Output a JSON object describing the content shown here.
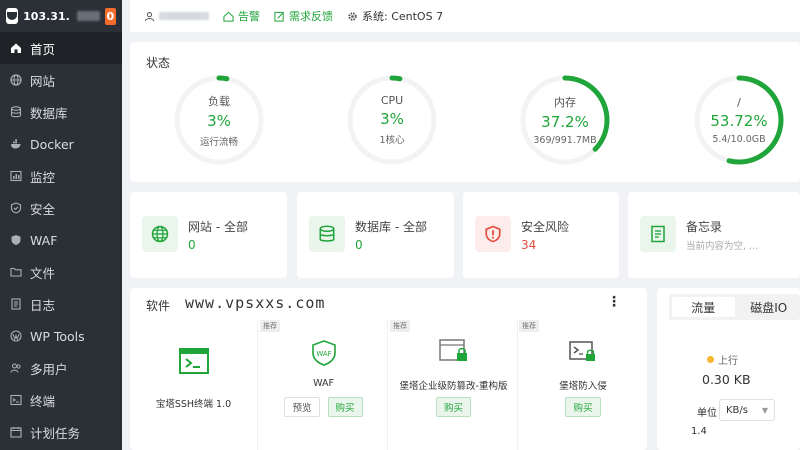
{
  "sidebar": {
    "ip": "103.31.",
    "badge": "0",
    "items": [
      {
        "label": "首页",
        "icon": "home-icon"
      },
      {
        "label": "网站",
        "icon": "globe-icon"
      },
      {
        "label": "数据库",
        "icon": "database-icon"
      },
      {
        "label": "Docker",
        "icon": "docker-icon"
      },
      {
        "label": "监控",
        "icon": "monitor-icon"
      },
      {
        "label": "安全",
        "icon": "shield-icon"
      },
      {
        "label": "WAF",
        "icon": "waf-shield-icon"
      },
      {
        "label": "文件",
        "icon": "folder-icon"
      },
      {
        "label": "日志",
        "icon": "log-icon"
      },
      {
        "label": "WP Tools",
        "icon": "wordpress-icon"
      },
      {
        "label": "多用户",
        "icon": "users-icon"
      },
      {
        "label": "终端",
        "icon": "terminal-icon"
      },
      {
        "label": "计划任务",
        "icon": "calendar-icon"
      }
    ]
  },
  "header": {
    "alert": "告警",
    "feedback": "需求反馈",
    "system": "系统:  CentOS 7"
  },
  "status": {
    "title": "状态",
    "gauges": [
      {
        "label": "负载",
        "value": "3%",
        "sub": "运行流畅",
        "percent": 3
      },
      {
        "label": "CPU",
        "value": "3%",
        "sub": "1核心",
        "percent": 3
      },
      {
        "label": "内存",
        "value": "37.2%",
        "sub": "369/991.7MB",
        "percent": 37.2
      },
      {
        "label": "/",
        "value": "53.72%",
        "sub": "5.4/10.0GB",
        "percent": 53.72
      }
    ]
  },
  "summary": [
    {
      "title": "网站 - 全部",
      "value": "0"
    },
    {
      "title": "数据库 - 全部",
      "value": "0"
    },
    {
      "title": "安全风险",
      "value": "34"
    },
    {
      "title": "备忘录",
      "value": "当前内容为空, ..."
    }
  ],
  "software": {
    "title": "软件",
    "watermark": "www.vpsxxs.com",
    "apps": [
      {
        "name": "宝塔SSH终端 1.0",
        "tag": ""
      },
      {
        "name": "WAF",
        "tag": "推荐",
        "preview": "预览",
        "buy": "购买"
      },
      {
        "name": "堡塔企业级防篡改-重构版",
        "tag": "推荐",
        "buy": "购买"
      },
      {
        "name": "堡塔防入侵",
        "tag": "推荐",
        "buy": "购买"
      }
    ]
  },
  "traffic": {
    "tab_traffic": "流量",
    "tab_disk": "磁盘IO",
    "legend_up": "上行",
    "up_value": "0.30 KB",
    "unit_label": "单位",
    "unit_value": "KB/s",
    "tick": "1.4"
  },
  "colors": {
    "accent": "#20a53a",
    "danger": "#e74c3c",
    "sidebar": "#2b2f36"
  }
}
